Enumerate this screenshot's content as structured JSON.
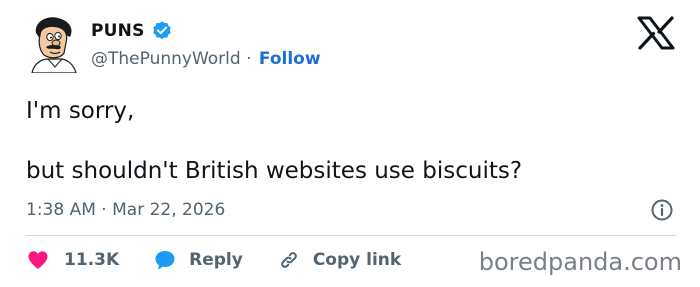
{
  "author": {
    "display_name": "PUNS",
    "handle": "@ThePunnyWorld",
    "separator": "·",
    "follow_label": "Follow",
    "avatar_icon": "bob-cartoon-avatar",
    "verified_icon": "verified-badge-icon"
  },
  "platform_icon": "x-logo-icon",
  "tweet": {
    "line1": "I'm sorry,",
    "line2": "but shouldn't British websites use biscuits?"
  },
  "meta": {
    "time": "1:38 AM",
    "separator": "·",
    "date": "Mar 22, 2026"
  },
  "actions": {
    "likes": "11.3K",
    "reply_label": "Reply",
    "copy_label": "Copy link"
  },
  "watermark": "boredpanda.com",
  "colors": {
    "accent": "#1d9bf0",
    "like": "#f91880",
    "follow": "#1d6fd6",
    "secondary_text": "#536471"
  }
}
